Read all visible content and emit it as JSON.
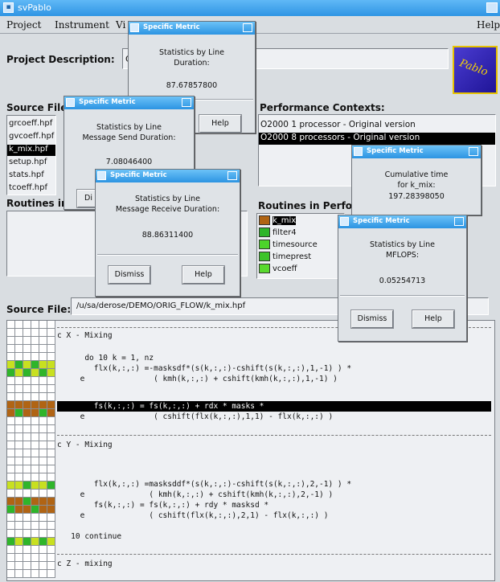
{
  "window": {
    "title": "svPablo"
  },
  "menu": {
    "project": "Project",
    "instrument": "Instrument",
    "view": "Vi",
    "help": "Help"
  },
  "project": {
    "label": "Project Description:",
    "value": "Cr",
    "logo_text": "Pablo"
  },
  "source_files": {
    "label": "Source Files",
    "items": [
      "grcoeff.hpf",
      "gvcoeff.hpf",
      "k_mix.hpf",
      "setup.hpf",
      "stats.hpf",
      "tcoeff.hpf"
    ],
    "selected_index": 2
  },
  "routines": {
    "label": "Routines in"
  },
  "performance_contexts": {
    "label": "Performance Contexts:",
    "items": [
      "O2000 1 processor  -  Original version",
      "O2000 8 processors - Original version"
    ],
    "selected_index": 1
  },
  "routines_perf": {
    "label": "Routines in Perform",
    "items": [
      {
        "name": "k_mix",
        "color": "#b06414",
        "selected": true
      },
      {
        "name": "filter4",
        "color": "#2fb52a"
      },
      {
        "name": "timesource",
        "color": "#4cd42a"
      },
      {
        "name": "timeprest",
        "color": "#3cc42a"
      },
      {
        "name": "vcoeff",
        "color": "#59d92f"
      }
    ]
  },
  "source_file": {
    "label": "Source File:",
    "path": "/u/sa/derose/DEMO/ORIG_FLOW/k_mix.hpf"
  },
  "code_lines": [
    "c X - Mixing",
    "      do 10 k = 1, nz",
    "        flx(k,:,:) =-masksdf*(s(k,:,:)-cshift(s(k,:,:),1,-1) ) *",
    "     e               ( kmh(k,:,:) + cshift(kmh(k,:,:),1,-1) )",
    "        fs(k,:,:) = fs(k,:,:) + rdx * masks *",
    "     e               ( cshift(flx(k,:,:),1,1) - flx(k,:,:) )",
    "c Y - Mixing",
    "        flx(k,:,:) =masksddf*(s(k,:,:)-cshift(s(k,:,:),2,-1) ) *",
    "     e              ( kmh(k,:,:) + cshift(kmh(k,:,:),2,-1) )",
    "        fs(k,:,:) = fs(k,:,:) + rdy * masksd *",
    "     e              ( cshift(flx(k,:,:),2,1) - flx(k,:,:) )",
    "   10 continue",
    "c Z - mixing"
  ],
  "dialogs": [
    {
      "title": "Specific Metric",
      "msg1": "Statistics by Line",
      "msg2": "Duration:",
      "value": "87.67857800",
      "help": "Help"
    },
    {
      "title": "Specific Metric",
      "msg1": "Statistics by Line",
      "msg2": "Message Send Duration:",
      "value": "7.08046400",
      "dismiss": "Di"
    },
    {
      "title": "Specific Metric",
      "msg1": "Statistics by Line",
      "msg2": "Message Receive Duration:",
      "value": "88.86311400",
      "dismiss": "Dismiss",
      "help": "Help"
    },
    {
      "title": "Specific Metric",
      "msg1": "Cumulative time",
      "msg2": "for k_mix:",
      "value": "197.28398050"
    },
    {
      "title": "Specific Metric",
      "msg1": "Statistics by Line",
      "msg2": "MFLOPS:",
      "value": "0.05254713",
      "dismiss": "Dismiss",
      "help": "Help"
    }
  ],
  "colors": {
    "titlebar": "#2f95e4",
    "hot": "#b06414",
    "warm": "#2fb52a",
    "cool": "#c8e020"
  }
}
